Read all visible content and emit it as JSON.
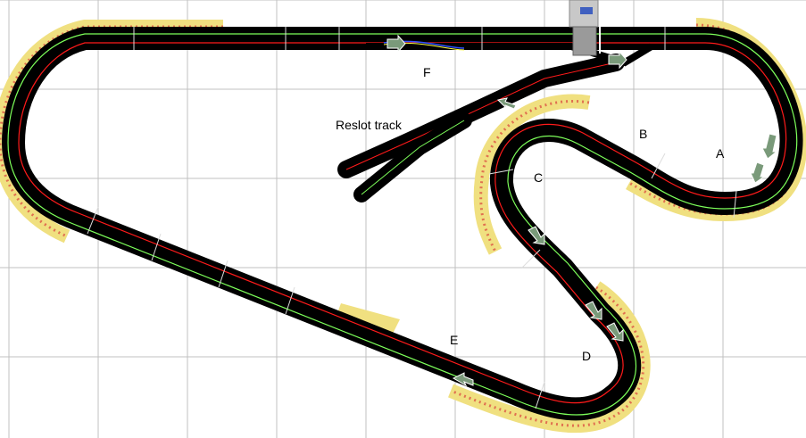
{
  "labels": {
    "a": "A",
    "b": "B",
    "c": "C",
    "d": "D",
    "e": "E",
    "f": "F",
    "reslot": "Reslot track"
  },
  "colors": {
    "background": "#ffffff",
    "grid": "#c0c0c0",
    "track": "#000000",
    "lane_red": "#ff1a1a",
    "lane_green": "#7dff5a",
    "border": "#f0e080",
    "border_dots": "#e07050",
    "arrow": "#7a9a7a",
    "tower": "#c8c8c8"
  },
  "icons": {
    "direction_arrow": "direction-arrow-icon",
    "race_tower": "race-control-tower-icon"
  }
}
